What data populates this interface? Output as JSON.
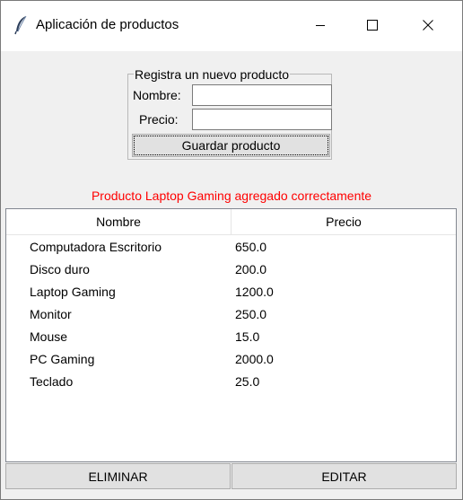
{
  "window": {
    "title": "Aplicación de productos",
    "icon": "feather-icon",
    "controls": [
      "minimize-icon",
      "maximize-icon",
      "close-icon"
    ]
  },
  "form": {
    "legend": "Registra un nuevo producto",
    "nombre_label": "Nombre:",
    "nombre_value": "",
    "precio_label": "Precio:",
    "precio_value": "",
    "save_label": "Guardar producto"
  },
  "status": {
    "message": "Producto Laptop Gaming agregado correctamente",
    "color": "#ff0000"
  },
  "table": {
    "columns": [
      "Nombre",
      "Precio"
    ],
    "rows": [
      {
        "nombre": "Computadora Escritorio",
        "precio": "650.0"
      },
      {
        "nombre": "Disco duro",
        "precio": "200.0"
      },
      {
        "nombre": "Laptop Gaming",
        "precio": "1200.0"
      },
      {
        "nombre": "Monitor",
        "precio": "250.0"
      },
      {
        "nombre": "Mouse",
        "precio": "15.0"
      },
      {
        "nombre": "PC Gaming",
        "precio": "2000.0"
      },
      {
        "nombre": "Teclado",
        "precio": "25.0"
      }
    ]
  },
  "actions": {
    "eliminar_label": "ELIMINAR",
    "editar_label": "EDITAR"
  }
}
